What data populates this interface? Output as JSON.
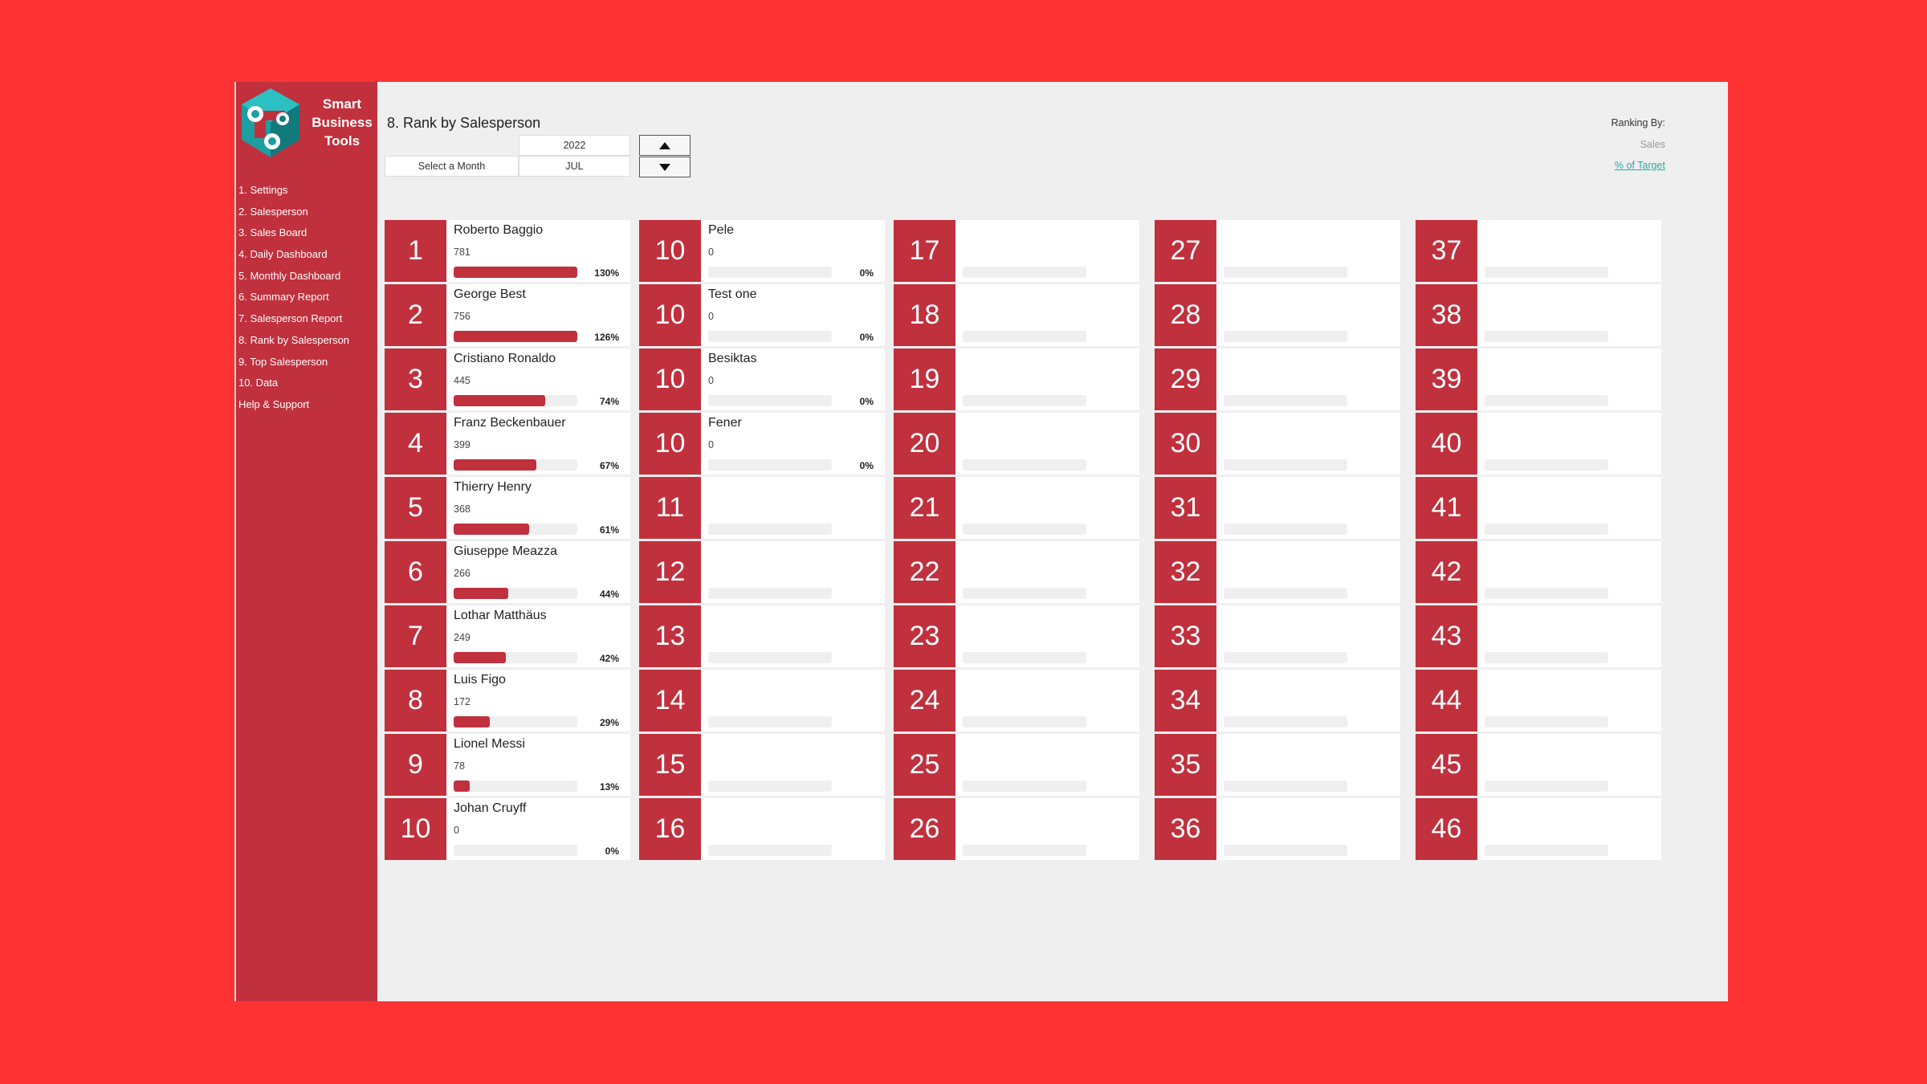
{
  "brand": {
    "line1": "Smart",
    "line2": "Business",
    "line3": "Tools"
  },
  "nav": [
    "1. Settings",
    "2. Salesperson",
    "3. Sales Board",
    "4. Daily Dashboard",
    "5. Monthly Dashboard",
    "6. Summary Report",
    "7. Salesperson Report",
    "8. Rank by Salesperson",
    "9. Top Salesperson",
    "10. Data",
    "Help & Support"
  ],
  "page_title": "8. Rank by Salesperson",
  "filters": {
    "year": "2022",
    "month_label": "Select a Month",
    "month": "JUL"
  },
  "ranking": {
    "label": "Ranking By:",
    "option_sales": "Sales",
    "option_target": "% of Target"
  },
  "colors": {
    "accent": "#c0303d",
    "background": "#ff3334",
    "link": "#2aa9a7"
  },
  "icons": {
    "up": "triangle-up-icon",
    "down": "triangle-down-icon",
    "logo": "hexagon-logo-icon"
  },
  "cards": [
    {
      "rank": "1",
      "name": "Roberto Baggio",
      "value": "781",
      "pct": "130%",
      "fill": 1.0
    },
    {
      "rank": "2",
      "name": "George Best",
      "value": "756",
      "pct": "126%",
      "fill": 1.0
    },
    {
      "rank": "3",
      "name": "Cristiano Ronaldo",
      "value": "445",
      "pct": "74%",
      "fill": 0.74
    },
    {
      "rank": "4",
      "name": "Franz Beckenbauer",
      "value": "399",
      "pct": "67%",
      "fill": 0.67
    },
    {
      "rank": "5",
      "name": "Thierry Henry",
      "value": "368",
      "pct": "61%",
      "fill": 0.61
    },
    {
      "rank": "6",
      "name": "Giuseppe Meazza",
      "value": "266",
      "pct": "44%",
      "fill": 0.44
    },
    {
      "rank": "7",
      "name": "Lothar Matthäus",
      "value": "249",
      "pct": "42%",
      "fill": 0.42
    },
    {
      "rank": "8",
      "name": "Luis Figo",
      "value": "172",
      "pct": "29%",
      "fill": 0.29
    },
    {
      "rank": "9",
      "name": "Lionel Messi",
      "value": "78",
      "pct": "13%",
      "fill": 0.13
    },
    {
      "rank": "10",
      "name": "Johan Cruyff",
      "value": "0",
      "pct": "0%",
      "fill": 0
    },
    {
      "rank": "10",
      "name": "Pele",
      "value": "0",
      "pct": "0%",
      "fill": 0
    },
    {
      "rank": "10",
      "name": "Test one",
      "value": "0",
      "pct": "0%",
      "fill": 0
    },
    {
      "rank": "10",
      "name": "Besiktas",
      "value": "0",
      "pct": "0%",
      "fill": 0
    },
    {
      "rank": "10",
      "name": "Fener",
      "value": "0",
      "pct": "0%",
      "fill": 0
    },
    {
      "rank": "11"
    },
    {
      "rank": "12"
    },
    {
      "rank": "13"
    },
    {
      "rank": "14"
    },
    {
      "rank": "15"
    },
    {
      "rank": "16"
    },
    {
      "rank": "17"
    },
    {
      "rank": "18"
    },
    {
      "rank": "19"
    },
    {
      "rank": "20"
    },
    {
      "rank": "21"
    },
    {
      "rank": "22"
    },
    {
      "rank": "23"
    },
    {
      "rank": "24"
    },
    {
      "rank": "25"
    },
    {
      "rank": "26"
    },
    {
      "rank": "27"
    },
    {
      "rank": "28"
    },
    {
      "rank": "29"
    },
    {
      "rank": "30"
    },
    {
      "rank": "31"
    },
    {
      "rank": "32"
    },
    {
      "rank": "33"
    },
    {
      "rank": "34"
    },
    {
      "rank": "35"
    },
    {
      "rank": "36"
    },
    {
      "rank": "37"
    },
    {
      "rank": "38"
    },
    {
      "rank": "39"
    },
    {
      "rank": "40"
    },
    {
      "rank": "41"
    },
    {
      "rank": "42"
    },
    {
      "rank": "43"
    },
    {
      "rank": "44"
    },
    {
      "rank": "45"
    },
    {
      "rank": "46"
    }
  ]
}
